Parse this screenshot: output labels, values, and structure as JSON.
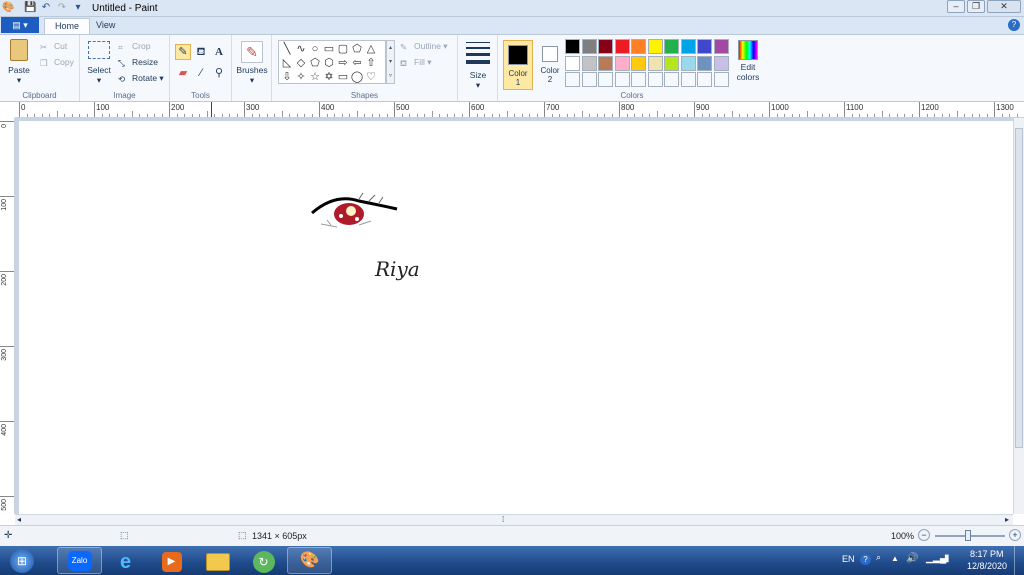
{
  "window": {
    "title": "Untitled - Paint"
  },
  "tabs": {
    "file_label": "▤ ▾",
    "home": "Home",
    "view": "View"
  },
  "clipboard": {
    "paste": "Paste",
    "cut": "Cut",
    "copy": "Copy",
    "group": "Clipboard"
  },
  "image": {
    "select": "Select",
    "crop": "Crop",
    "resize": "Resize",
    "rotate": "Rotate",
    "group": "Image"
  },
  "tools": {
    "group": "Tools",
    "text_glyph": "A"
  },
  "brushes": {
    "label": "Brushes"
  },
  "shapes": {
    "outline": "Outline",
    "fill": "Fill",
    "group": "Shapes"
  },
  "size": {
    "label": "Size"
  },
  "colors": {
    "color1_label": "Color",
    "color1_num": "1",
    "color2_label": "Color",
    "color2_num": "2",
    "edit_colors": "Edit colors",
    "group": "Colors",
    "color1": "#000000",
    "color2": "#ffffff",
    "row1": [
      "#000000",
      "#7f7f7f",
      "#880015",
      "#ed1c24",
      "#ff7f27",
      "#fff200",
      "#22b14c",
      "#00a2e8",
      "#3f48cc",
      "#a349a4"
    ],
    "row2": [
      "#ffffff",
      "#c3c3c3",
      "#b97a57",
      "#ffaec9",
      "#ffc90e",
      "#efe4b0",
      "#b5e61d",
      "#99d9ea",
      "#7092be",
      "#c8bfe7"
    ]
  },
  "ruler": {
    "top": [
      "0",
      "100",
      "200",
      "300",
      "400",
      "500",
      "600",
      "700",
      "800",
      "900",
      "1000",
      "1100",
      "1200",
      "1300"
    ],
    "left": [
      "0",
      "100",
      "200",
      "300",
      "400",
      "500"
    ]
  },
  "canvas": {
    "handwriting": "Riya"
  },
  "status": {
    "dimensions": "1341 × 605px",
    "zoom": "100%"
  },
  "taskbar": {
    "zalo": "Zalo",
    "lang": "EN",
    "time": "8:17 PM",
    "date": "12/8/2020"
  }
}
